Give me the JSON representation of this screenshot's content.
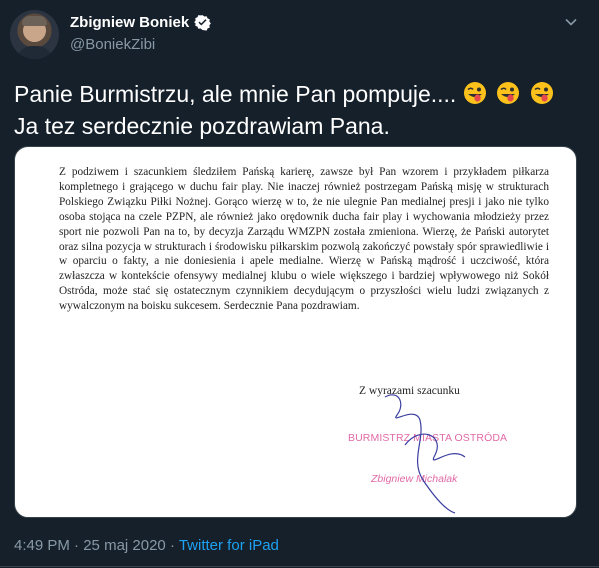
{
  "user": {
    "display_name": "Zbigniew Boniek",
    "handle": "@BoniekZibi",
    "verified_icon": "verified-badge-icon",
    "menu_icon": "chevron-down-icon"
  },
  "tweet": {
    "text_part1": "Panie Burmistrzu, ale mnie Pan pompuje....",
    "emojis": [
      "face-with-tongue-winking",
      "face-with-tongue-winking",
      "face-with-tongue-winking"
    ],
    "text_part2": " Ja tez serdecznie pozdrawiam Pana."
  },
  "letter": {
    "paragraph1": "Z podziwem i szacunkiem śledziłem Pańską karierę, zawsze był Pan wzorem i przykładem piłkarza kompletnego i grającego w duchu fair play. Nie inaczej również postrzegam Pańską misję w strukturach Polskiego Związku Piłki Nożnej. Gorąco wierzę w to, że nie ulegnie Pan medialnej presji i jako nie tylko osoba stojąca na czele PZPN, ale również jako orędownik ducha fair play i wychowania młodzieży przez sport nie pozwoli Pan na to, by decyzja Zarządu WMZPN została zmieniona.",
    "paragraph2": "Wierzę, że Pański autorytet oraz silna pozycja w strukturach i środowisku piłkarskim pozwolą zakończyć powstały spór sprawiedliwie i w oparciu o fakty, a nie doniesienia i apele medialne. Wierzę w Pańską mądrość i uczciwość, która zwłaszcza w kontekście ofensywy medialnej klubu o wiele większego i bardziej wpływowego niż Sokół Ostróda, może stać się ostatecznym czynnikiem decydującym o przyszłości wielu ludzi związanych z wywalczonym na boisku sukcesem.",
    "greeting": "Serdecznie Pana pozdrawiam.",
    "closing": "Z wyrazami szacunku",
    "stamp_title": "BURMISTRZ MIASTA OSTRÓDA",
    "stamp_name": "Zbigniew Michalak"
  },
  "footer": {
    "time": "4:49 PM",
    "separator1": " · ",
    "date": "25 maj 2020",
    "separator2": " · ",
    "source": "Twitter for iPad"
  },
  "colors": {
    "background": "#15202b",
    "secondary_text": "#8899a6",
    "link": "#1da1f2",
    "stamp": "#e06aa6"
  }
}
